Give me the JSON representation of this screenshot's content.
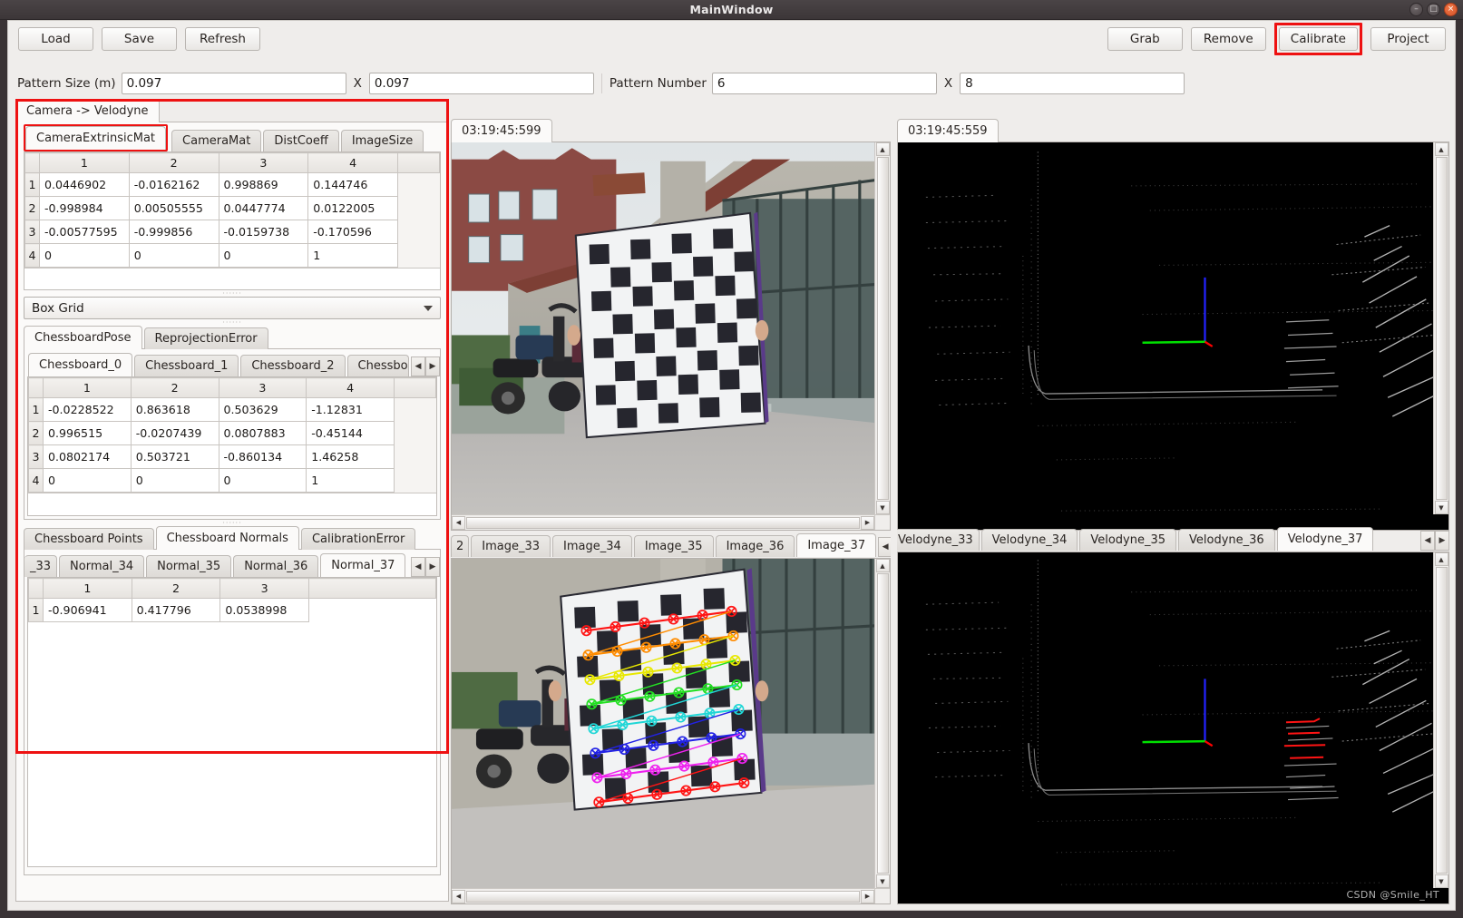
{
  "window": {
    "title": "MainWindow",
    "minimize_label": "–",
    "maximize_label": "□",
    "close_label": "×"
  },
  "toolbar": {
    "load_label": "Load",
    "save_label": "Save",
    "refresh_label": "Refresh",
    "grab_label": "Grab",
    "remove_label": "Remove",
    "calibrate_label": "Calibrate",
    "project_label": "Project"
  },
  "params": {
    "pattern_size_label": "Pattern Size (m)",
    "pattern_size_x": "0.097",
    "pattern_size_sep": "X",
    "pattern_size_y": "0.097",
    "pattern_number_label": "Pattern Number",
    "pattern_number_x": "6",
    "pattern_number_sep": "X",
    "pattern_number_y": "8"
  },
  "left_panel": {
    "main_tab": "Camera -> Velodyne",
    "matrix_tabs": [
      "CameraExtrinsicMat",
      "CameraMat",
      "DistCoeff",
      "ImageSize"
    ],
    "matrix_selected": "CameraExtrinsicMat",
    "extrinsic_headers": [
      "1",
      "2",
      "3",
      "4"
    ],
    "extrinsic_rows": [
      {
        "index": "1",
        "cells": [
          "0.0446902",
          "-0.0162162",
          "0.998869",
          "0.144746"
        ]
      },
      {
        "index": "2",
        "cells": [
          "-0.998984",
          "0.00505555",
          "0.0447774",
          "0.0122005"
        ]
      },
      {
        "index": "3",
        "cells": [
          "-0.00577595",
          "-0.999856",
          "-0.0159738",
          "-0.170596"
        ]
      },
      {
        "index": "4",
        "cells": [
          "0",
          "0",
          "0",
          "1"
        ]
      }
    ],
    "combo_value": "Box Grid",
    "pose_tabs": [
      "ChessboardPose",
      "ReprojectionError"
    ],
    "pose_selected": "ChessboardPose",
    "chessboard_tabs": [
      "Chessboard_0",
      "Chessboard_1",
      "Chessboard_2",
      "Chessboa"
    ],
    "chessboard_selected": "Chessboard_0",
    "chessboard_nav_prev": "◀",
    "chessboard_nav_next": "▶",
    "pose_headers": [
      "1",
      "2",
      "3",
      "4"
    ],
    "pose_rows": [
      {
        "index": "1",
        "cells": [
          "-0.0228522",
          "0.863618",
          "0.503629",
          "-1.12831"
        ]
      },
      {
        "index": "2",
        "cells": [
          "0.996515",
          "-0.0207439",
          "0.0807883",
          "-0.45144"
        ]
      },
      {
        "index": "3",
        "cells": [
          "0.0802174",
          "0.503721",
          "-0.860134",
          "1.46258"
        ]
      },
      {
        "index": "4",
        "cells": [
          "0",
          "0",
          "0",
          "1"
        ]
      }
    ],
    "points_tabs": [
      "Chessboard Points",
      "Chessboard Normals",
      "CalibrationError"
    ],
    "points_selected": "Chessboard Normals",
    "normal_tabs": [
      "_33",
      "Normal_34",
      "Normal_35",
      "Normal_36",
      "Normal_37"
    ],
    "normal_selected": "Normal_37",
    "normal_nav_prev": "◀",
    "normal_nav_next": "▶",
    "normal_headers": [
      "1",
      "2",
      "3"
    ],
    "normal_rows": [
      {
        "index": "1",
        "cells": [
          "-0.906941",
          "0.417796",
          "0.0538998"
        ]
      }
    ]
  },
  "image_pane_top": {
    "timestamp_tab": "03:19:45:599",
    "bottom_tabs": [
      "2",
      "Image_33",
      "Image_34",
      "Image_35",
      "Image_36",
      "Image_37"
    ],
    "bottom_selected": "Image_37",
    "nav_prev": "◀",
    "nav_next": "▶"
  },
  "image_pane_bottom": {
    "bottom_tabs": [
      "2",
      "Image_33",
      "Image_34",
      "Image_35",
      "Image_36",
      "Image_37"
    ],
    "bottom_selected": "Image_37"
  },
  "velodyne_pane_top": {
    "timestamp_tab": "03:19:45:559",
    "bottom_tabs": [
      "Velodyne_33",
      "Velodyne_34",
      "Velodyne_35",
      "Velodyne_36",
      "Velodyne_37"
    ],
    "bottom_selected": "Velodyne_37",
    "nav_prev": "◀",
    "nav_next": "▶"
  },
  "watermark": "CSDN @Smile_HT",
  "colors": {
    "highlight": "#ee1111",
    "accent_blue": "#2222ff",
    "accent_green": "#00e000",
    "accent_red": "#ff0000",
    "window_bg": "#efedeb",
    "titlebar": "#413b3d"
  }
}
